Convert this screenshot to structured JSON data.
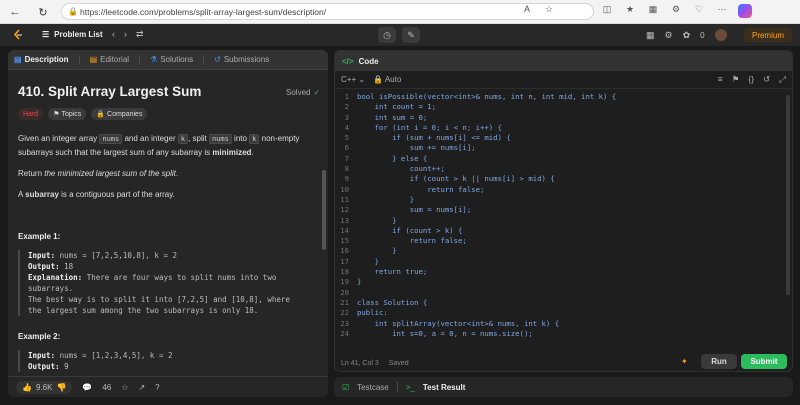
{
  "browser": {
    "url": "https://leetcode.com/problems/split-array-largest-sum/description/"
  },
  "topbar": {
    "problem_list": "Problem List",
    "fire_count": "0",
    "premium": "Premium"
  },
  "left_tabs": [
    {
      "label": "Description"
    },
    {
      "label": "Editorial"
    },
    {
      "label": "Solutions"
    },
    {
      "label": "Submissions"
    }
  ],
  "problem": {
    "title": "410. Split Array Largest Sum",
    "solved_label": "Solved",
    "difficulty": "Hard",
    "topics_label": "Topics",
    "companies_label": "Companies",
    "desc1_a": "Given an integer array ",
    "desc1_nums": "nums",
    "desc1_b": " and an integer ",
    "desc1_k": "k",
    "desc1_c": ", split ",
    "desc1_nums2": "nums",
    "desc1_d": " into ",
    "desc1_k2": "k",
    "desc1_e": " non-empty subarrays such that the largest sum of any subarray is ",
    "desc1_bold": "minimized",
    "desc1_end": ".",
    "desc2_a": "Return ",
    "desc2_em": "the minimized largest sum of the split",
    "desc2_end": ".",
    "desc3_a": "A ",
    "desc3_bold": "subarray",
    "desc3_b": " is a contiguous part of the array.",
    "example1_title": "Example 1:",
    "example1_input_label": "Input:",
    "example1_input": " nums = [7,2,5,10,8], k = 2",
    "example1_output_label": "Output:",
    "example1_output": " 18",
    "example1_expl_label": "Explanation:",
    "example1_expl_1": " There are four ways to split nums into two",
    "example1_expl_2": "subarrays.",
    "example1_expl_3": "The best way is to split it into [7,2,5] and [10,8], where",
    "example1_expl_4": "the largest sum among the two subarrays is only 18.",
    "example2_title": "Example 2:",
    "example2_input_label": "Input:",
    "example2_input": " nums = [1,2,3,4,5], k = 2",
    "example2_output_label": "Output:",
    "example2_output": " 9"
  },
  "footer": {
    "likes": "9.6K",
    "comments": "46"
  },
  "code_panel": {
    "title": "Code",
    "language": "C++",
    "mode": "Auto",
    "status_pos": "Ln 41, Col 3",
    "status_saved": "Saved",
    "run": "Run",
    "submit": "Submit",
    "lines": [
      "bool isPossible(vector<int>& nums, int n, int mid, int k) {",
      "    int count = 1;",
      "    int sum = 0;",
      "    for (int i = 0; i < n; i++) {",
      "        if (sum + nums[i] <= mid) {",
      "            sum += nums[i];",
      "        } else {",
      "            count++;",
      "            if (count > k || nums[i] > mid) {",
      "                return false;",
      "            }",
      "            sum = nums[i];",
      "        }",
      "        if (count > k) {",
      "            return false;",
      "        }",
      "    }",
      "    return true;",
      "}",
      "",
      "class Solution {",
      "public:",
      "    int splitArray(vector<int>& nums, int k) {",
      "        int s=0, a = 0, n = nums.size();"
    ]
  },
  "bottom_tabs": {
    "testcase": "Testcase",
    "test_result": "Test Result"
  }
}
